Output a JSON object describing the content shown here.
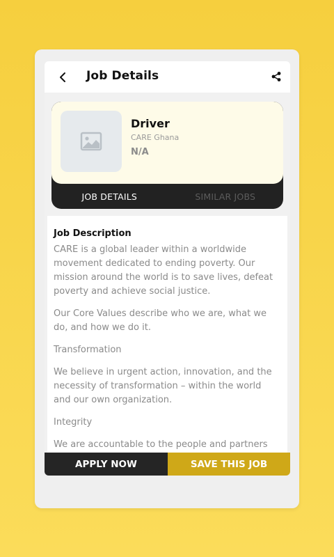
{
  "header": {
    "title": "Job Details",
    "back_icon": "arrow-left-icon",
    "share_icon": "share-icon"
  },
  "job": {
    "logo_icon": "image-placeholder-icon",
    "title": "Driver",
    "company": "CARE Ghana",
    "salary": "N/A"
  },
  "tabs": [
    {
      "label": "JOB DETAILS",
      "active": true
    },
    {
      "label": "SIMILAR JOBS",
      "active": false
    }
  ],
  "description": {
    "heading": "Job Description",
    "paragraphs": [
      "CARE is a global leader within a worldwide movement dedicated to ending poverty. Our mission around the world is to save lives, defeat poverty and achieve social justice.",
      "Our Core Values describe who we are, what we do, and how we do it.",
      "Transformation",
      "We believe in urgent action, innovation, and the necessity of transformation – within the world and our own organization.",
      "Integrity",
      "We are accountable to the people and partners"
    ]
  },
  "actions": {
    "apply_label": "APPLY NOW",
    "save_label": "SAVE THIS JOB"
  },
  "colors": {
    "background": "#f6cf3e",
    "accent": "#cfa818",
    "dark": "#252525"
  }
}
